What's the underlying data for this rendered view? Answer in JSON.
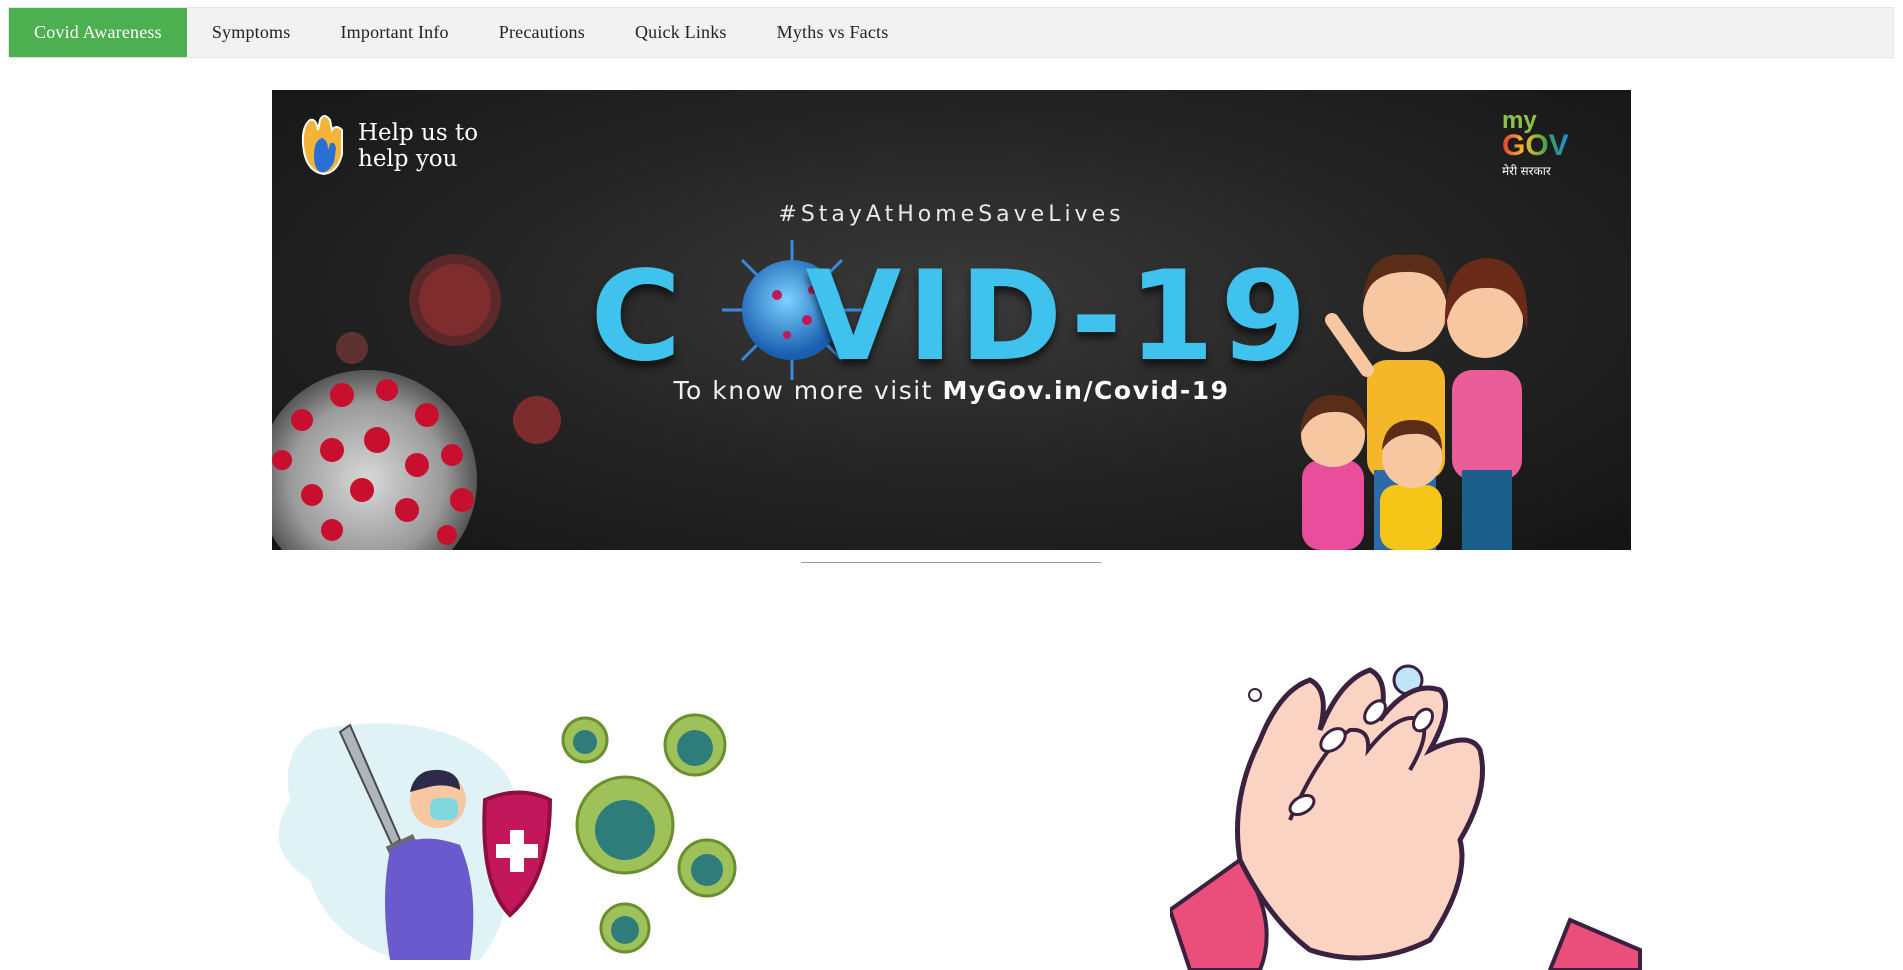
{
  "nav": {
    "items": [
      {
        "label": "Covid Awareness",
        "active": true
      },
      {
        "label": "Symptoms",
        "active": false
      },
      {
        "label": "Important Info",
        "active": false
      },
      {
        "label": "Precautions",
        "active": false
      },
      {
        "label": "Quick Links",
        "active": false
      },
      {
        "label": "Myths vs Facts",
        "active": false
      }
    ],
    "active_color": "#4caf50"
  },
  "banner": {
    "help_line1": "Help us to",
    "help_line2": "help you",
    "hashtag": "#StayAtHomeSaveLives",
    "title_left": "C",
    "title_right": "VID-19",
    "visit_prefix": "To know more visit ",
    "visit_link": "MyGov.in/Covid-19",
    "logo_my": "my",
    "logo_gov": "GOV",
    "logo_sub": "मेरी सरकार",
    "accent": "#3fc3ee"
  },
  "illustrations": {
    "left": "person-with-sword-and-shield-fighting-virus",
    "right": "hand-washing"
  }
}
